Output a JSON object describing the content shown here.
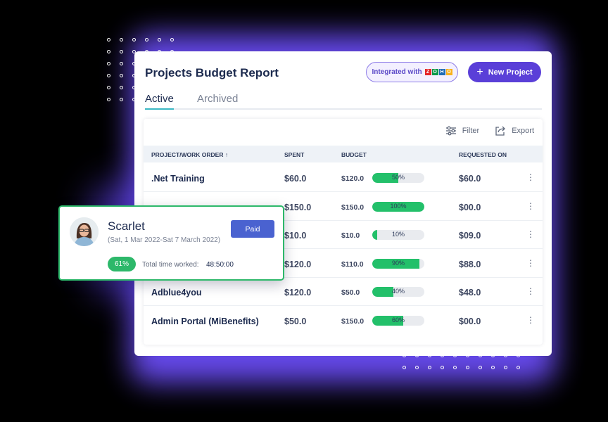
{
  "report": {
    "title": "Projects Budget Report",
    "integration_badge": "Integrated with",
    "integration_logo_icon": "zoho-logo-icon",
    "integration_logo_letters": [
      "Z",
      "O",
      "H",
      "O"
    ],
    "integration_logo_colors": [
      "#e42527",
      "#089949",
      "#226db4",
      "#f9b21d"
    ],
    "new_project_label": "New Project",
    "accent_color": "#5a3fd8"
  },
  "tabs": [
    {
      "label": "Active",
      "active": true
    },
    {
      "label": "Archived",
      "active": false
    }
  ],
  "toolbar": {
    "filter_label": "Filter",
    "export_label": "Export"
  },
  "table": {
    "headers": {
      "project": "PROJECT/WORK ORDER ↑",
      "spent": "SPENT",
      "budget": "BUDGET",
      "requested_on": "REQUESTED ON"
    },
    "rows": [
      {
        "name": ".Net Training",
        "spent": "$60.0",
        "budget": "$120.0",
        "progress": 50,
        "progress_label": "50%",
        "requested": "$60.0"
      },
      {
        "name": "",
        "spent": "$150.0",
        "budget": "$150.0",
        "progress": 100,
        "progress_label": "100%",
        "requested": "$00.0"
      },
      {
        "name": "",
        "spent": "$10.0",
        "budget": "$10.0",
        "progress": 10,
        "progress_label": "10%",
        "requested": "$09.0"
      },
      {
        "name": "",
        "spent": "$120.0",
        "budget": "$110.0",
        "progress": 90,
        "progress_label": "90%",
        "requested": "$88.0"
      },
      {
        "name": "Adblue4you",
        "spent": "$120.0",
        "budget": "$50.0",
        "progress": 40,
        "progress_label": "40%",
        "requested": "$48.0"
      },
      {
        "name": "Admin Portal (MiBenefits)",
        "spent": "$50.0",
        "budget": "$150.0",
        "progress": 60,
        "progress_label": "60%",
        "requested": "$00.0"
      }
    ]
  },
  "timesheet_card": {
    "name": "Scarlet",
    "date_range": "(Sat, 1 Mar 2022-Sat 7 March 2022)",
    "status": "Paid",
    "percent": "61%",
    "time_label": "Total time worked:",
    "time_value": "48:50:00"
  }
}
